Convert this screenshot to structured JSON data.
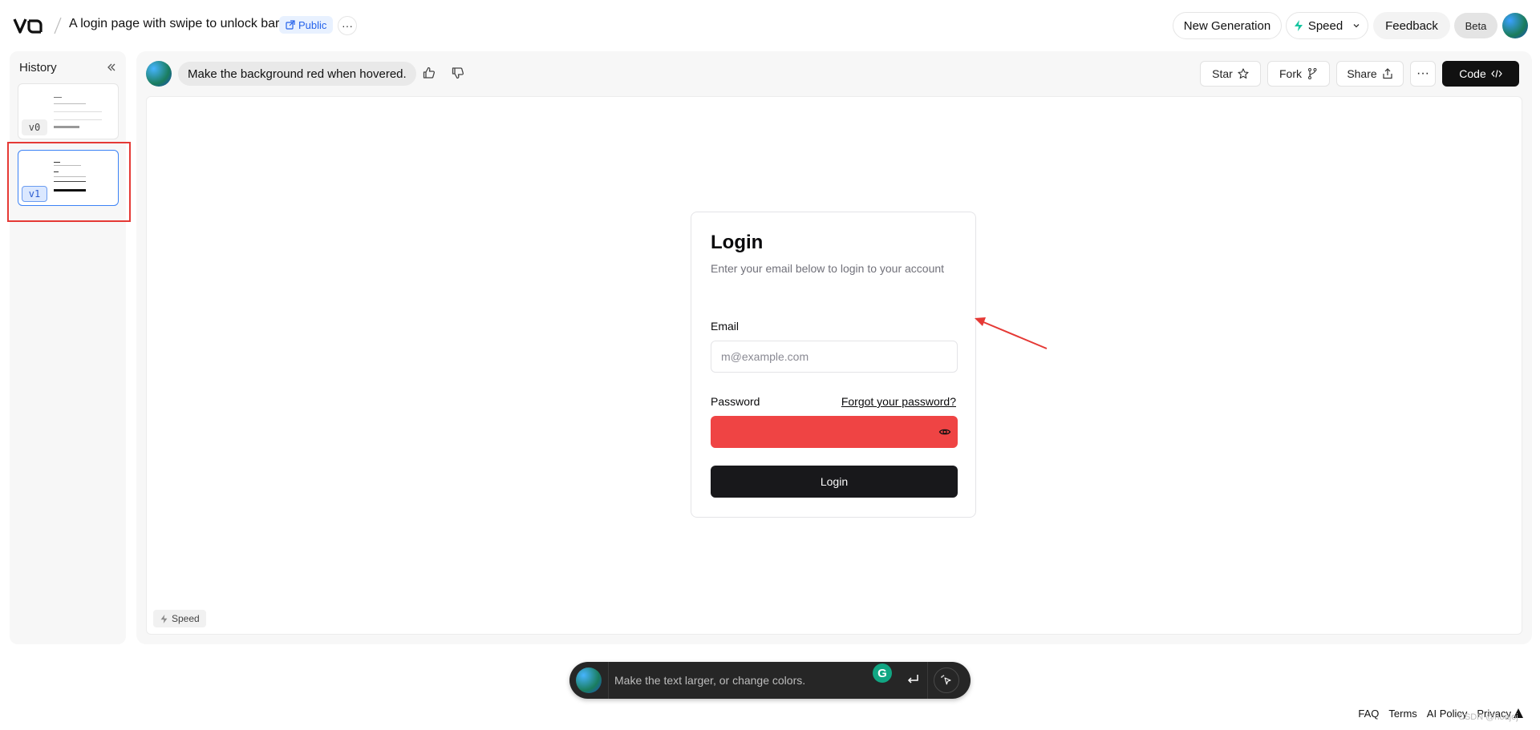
{
  "header": {
    "project_title": "A login page with swipe to unlock bar.",
    "visibility": "Public",
    "more_label": "···",
    "new_generation": "New Generation",
    "speed": "Speed",
    "feedback": "Feedback",
    "beta": "Beta"
  },
  "history": {
    "title": "History",
    "versions": [
      {
        "label": "v0",
        "selected": false
      },
      {
        "label": "v1",
        "selected": true
      }
    ]
  },
  "chat": {
    "prompt": "Make the background red when hovered."
  },
  "toolbar": {
    "star": "Star",
    "fork": "Fork",
    "share": "Share",
    "more": "···",
    "code": "Code"
  },
  "preview": {
    "title": "Login",
    "subtitle": "Enter your email below to login to your account",
    "email_label": "Email",
    "email_placeholder": "m@example.com",
    "password_label": "Password",
    "forgot": "Forgot your password?",
    "password_hover_color": "#ef4444",
    "login_button": "Login",
    "speed_chip": "Speed"
  },
  "composer": {
    "placeholder": "Make the text larger, or change colors.",
    "grammarly_letter": "G"
  },
  "footer": {
    "links": [
      "FAQ",
      "Terms",
      "AI Policy",
      "Privacy"
    ],
    "watermark": "CSDN @hoajoj"
  },
  "colors": {
    "accent_blue": "#3b82f6",
    "annotation_red": "#e53935",
    "hover_red": "#ef4444",
    "dark": "#18181b"
  }
}
